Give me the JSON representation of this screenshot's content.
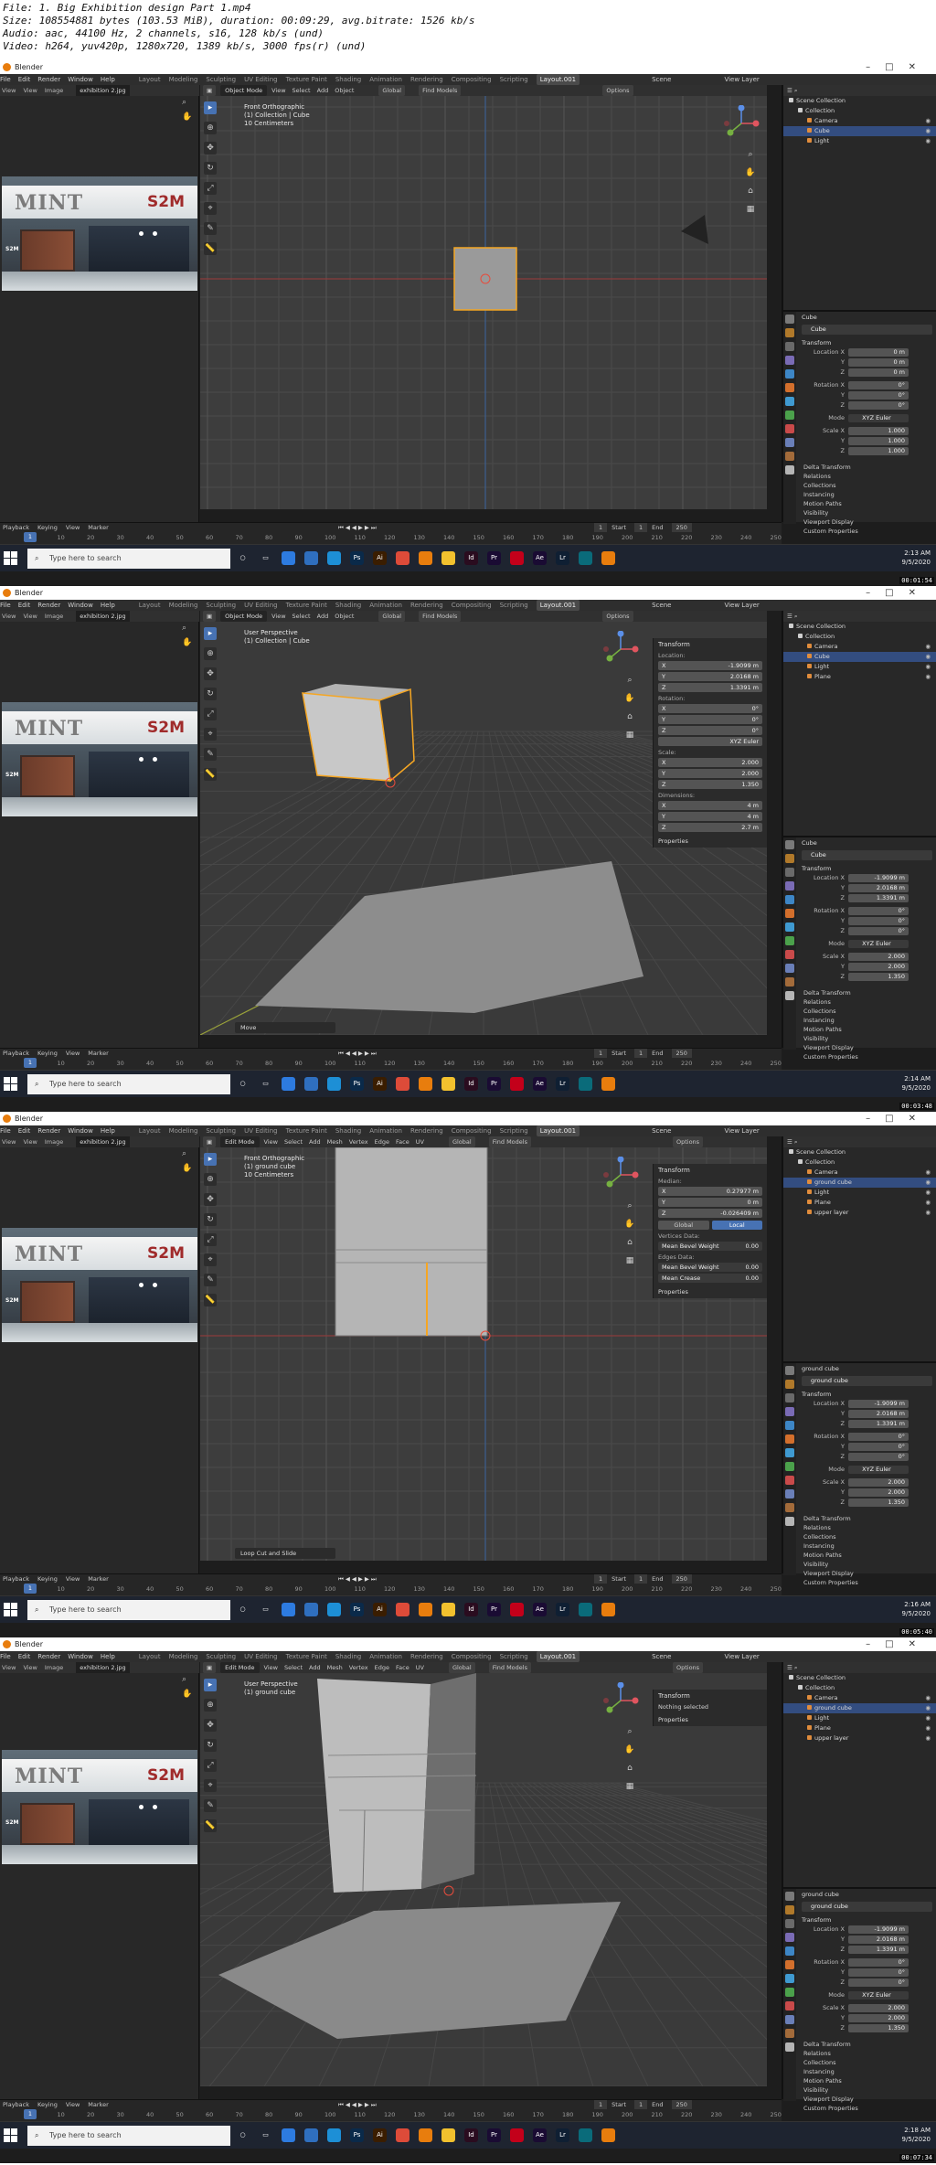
{
  "info": [
    "File: 1. Big Exhibition design Part 1.mp4",
    "Size: 108554881 bytes (103.53 MiB), duration: 00:09:29, avg.bitrate: 1526 kb/s",
    "Audio: aac, 44100 Hz, 2 channels, s16, 128 kb/s (und)",
    "Video: h264, yuv420p, 1280x720, 1389 kb/s, 3000 fps(r) (und)"
  ],
  "app_title": "Blender",
  "menus": [
    "File",
    "Edit",
    "Render",
    "Window",
    "Help"
  ],
  "workspaces": [
    "Layout",
    "Modeling",
    "Sculpting",
    "UV Editing",
    "Texture Paint",
    "Shading",
    "Animation",
    "Rendering",
    "Compositing",
    "Scripting",
    "Layout.001"
  ],
  "scene_label": "Scene",
  "view_layer_label": "View Layer",
  "image_editor": {
    "menus": [
      "View",
      "View",
      "Image"
    ],
    "filename": "exhibition 2.jpg",
    "logo": "MINT",
    "brand": "S2M",
    "sublabel": "S2M"
  },
  "header_menus_object": [
    "View",
    "Select",
    "Add",
    "Object"
  ],
  "header_menus_edit": [
    "View",
    "Select",
    "Add",
    "Mesh",
    "Vertex",
    "Edge",
    "Face",
    "UV"
  ],
  "orientation": "Global",
  "find_models": "Find Models",
  "options": "Options",
  "outliner_title": "Scene Collection",
  "props": {
    "transform": "Transform",
    "location_x": "Location X",
    "y": "Y",
    "z": "Z",
    "rotation_x": "Rotation X",
    "mode": "Mode",
    "scale_x": "Scale X",
    "sections": [
      "Delta Transform",
      "Relations",
      "Collections",
      "Instancing",
      "Motion Paths",
      "Visibility",
      "Viewport Display",
      "Custom Properties"
    ]
  },
  "timeline": {
    "menus": [
      "Playback",
      "Keying",
      "View",
      "Marker"
    ],
    "current": "1",
    "start_label": "Start",
    "start": "1",
    "end_label": "End",
    "end": "250",
    "ticks": [
      "0",
      "10",
      "20",
      "30",
      "40",
      "50",
      "60",
      "70",
      "80",
      "90",
      "100",
      "110",
      "120",
      "130",
      "140",
      "150",
      "160",
      "170",
      "180",
      "190",
      "200",
      "210",
      "220",
      "230",
      "240",
      "250"
    ]
  },
  "taskbar": {
    "search_placeholder": "Type here to search"
  },
  "frames": [
    {
      "mode": "Object Mode",
      "view_name": "Front Orthographic",
      "collection": "(1) Collection | Cube",
      "scale_note": "10 Centimeters",
      "outliner": [
        {
          "label": "Scene Collection",
          "level": 0,
          "sel": false
        },
        {
          "label": "Collection",
          "level": 1,
          "sel": false
        },
        {
          "label": "Camera",
          "level": 2,
          "sel": false
        },
        {
          "label": "Cube",
          "level": 2,
          "sel": true
        },
        {
          "label": "Light",
          "level": 2,
          "sel": false
        }
      ],
      "object_name": "Cube",
      "loc": [
        "0 m",
        "0 m",
        "0 m"
      ],
      "rot": [
        "0°",
        "0°",
        "0°"
      ],
      "rot_mode": "XYZ Euler",
      "scale": [
        "1.000",
        "1.000",
        "1.000"
      ],
      "npanel": null,
      "operator": "",
      "time": "2:13 AM",
      "date": "9/5/2020",
      "stamp": "00:01:54"
    },
    {
      "mode": "Object Mode",
      "view_name": "User Perspective",
      "collection": "(1) Collection | Cube",
      "scale_note": "",
      "outliner": [
        {
          "label": "Scene Collection",
          "level": 0,
          "sel": false
        },
        {
          "label": "Collection",
          "level": 1,
          "sel": false
        },
        {
          "label": "Camera",
          "level": 2,
          "sel": false
        },
        {
          "label": "Cube",
          "level": 2,
          "sel": true
        },
        {
          "label": "Light",
          "level": 2,
          "sel": false
        },
        {
          "label": "Plane",
          "level": 2,
          "sel": false
        }
      ],
      "object_name": "Cube",
      "loc": [
        "-1.9099 m",
        "2.0168 m",
        "1.3391 m"
      ],
      "rot": [
        "0°",
        "0°",
        "0°"
      ],
      "rot_mode": "XYZ Euler",
      "scale": [
        "2.000",
        "2.000",
        "1.350"
      ],
      "npanel": {
        "title": "Transform",
        "groups": [
          {
            "label": "Location:",
            "fields": [
              [
                "X",
                "-1.9099 m"
              ],
              [
                "Y",
                "2.0168 m"
              ],
              [
                "Z",
                "1.3391 m"
              ]
            ]
          },
          {
            "label": "Rotation:",
            "fields": [
              [
                "X",
                "0°"
              ],
              [
                "Y",
                "0°"
              ],
              [
                "Z",
                "0°"
              ]
            ]
          },
          {
            "label": "",
            "fields": [
              [
                "",
                "XYZ Euler"
              ]
            ]
          },
          {
            "label": "Scale:",
            "fields": [
              [
                "X",
                "2.000"
              ],
              [
                "Y",
                "2.000"
              ],
              [
                "Z",
                "1.350"
              ]
            ]
          },
          {
            "label": "Dimensions:",
            "fields": [
              [
                "X",
                "4 m"
              ],
              [
                "Y",
                "4 m"
              ],
              [
                "Z",
                "2.7 m"
              ]
            ]
          }
        ],
        "buttons": [],
        "extra": [],
        "props": "Properties"
      },
      "operator": "Move",
      "time": "2:14 AM",
      "date": "9/5/2020",
      "stamp": "00:03:48"
    },
    {
      "mode": "Edit Mode",
      "view_name": "Front Orthographic",
      "collection": "(1) ground cube",
      "scale_note": "10 Centimeters",
      "outliner": [
        {
          "label": "Scene Collection",
          "level": 0,
          "sel": false
        },
        {
          "label": "Collection",
          "level": 1,
          "sel": false
        },
        {
          "label": "Camera",
          "level": 2,
          "sel": false
        },
        {
          "label": "ground cube",
          "level": 2,
          "sel": true
        },
        {
          "label": "Light",
          "level": 2,
          "sel": false
        },
        {
          "label": "Plane",
          "level": 2,
          "sel": false
        },
        {
          "label": "upper layer",
          "level": 2,
          "sel": false
        }
      ],
      "object_name": "ground cube",
      "loc": [
        "-1.9099 m",
        "2.0168 m",
        "1.3391 m"
      ],
      "rot": [
        "0°",
        "0°",
        "0°"
      ],
      "rot_mode": "XYZ Euler",
      "scale": [
        "2.000",
        "2.000",
        "1.350"
      ],
      "npanel": {
        "title": "Transform",
        "groups": [
          {
            "label": "Median:",
            "fields": [
              [
                "X",
                "0.27977 m"
              ],
              [
                "Y",
                "0 m"
              ],
              [
                "Z",
                "-0.026409 m"
              ]
            ]
          }
        ],
        "buttons": [
          "Global",
          "Local"
        ],
        "extra": [
          {
            "label": "Vertices Data:",
            "fields": [
              [
                "Mean Bevel Weight",
                "0.00"
              ]
            ]
          },
          {
            "label": "Edges Data:",
            "fields": [
              [
                "Mean Bevel Weight",
                "0.00"
              ],
              [
                "Mean Crease",
                "0.00"
              ]
            ]
          }
        ],
        "props": "Properties"
      },
      "operator": "Loop Cut and Slide",
      "time": "2:16 AM",
      "date": "9/5/2020",
      "stamp": "00:05:40"
    },
    {
      "mode": "Edit Mode",
      "view_name": "User Perspective",
      "collection": "(1) ground cube",
      "scale_note": "",
      "outliner": [
        {
          "label": "Scene Collection",
          "level": 0,
          "sel": false
        },
        {
          "label": "Collection",
          "level": 1,
          "sel": false
        },
        {
          "label": "Camera",
          "level": 2,
          "sel": false
        },
        {
          "label": "ground cube",
          "level": 2,
          "sel": true
        },
        {
          "label": "Light",
          "level": 2,
          "sel": false
        },
        {
          "label": "Plane",
          "level": 2,
          "sel": false
        },
        {
          "label": "upper layer",
          "level": 2,
          "sel": false
        }
      ],
      "object_name": "ground cube",
      "loc": [
        "-1.9099 m",
        "2.0168 m",
        "1.3391 m"
      ],
      "rot": [
        "0°",
        "0°",
        "0°"
      ],
      "rot_mode": "XYZ Euler",
      "scale": [
        "2.000",
        "2.000",
        "1.350"
      ],
      "npanel": {
        "title": "Transform",
        "groups": [],
        "buttons": [],
        "extra": [],
        "nothing": "Nothing selected",
        "props": "Properties"
      },
      "operator": "",
      "time": "2:18 AM",
      "date": "9/5/2020",
      "stamp": "00:07:34"
    }
  ]
}
